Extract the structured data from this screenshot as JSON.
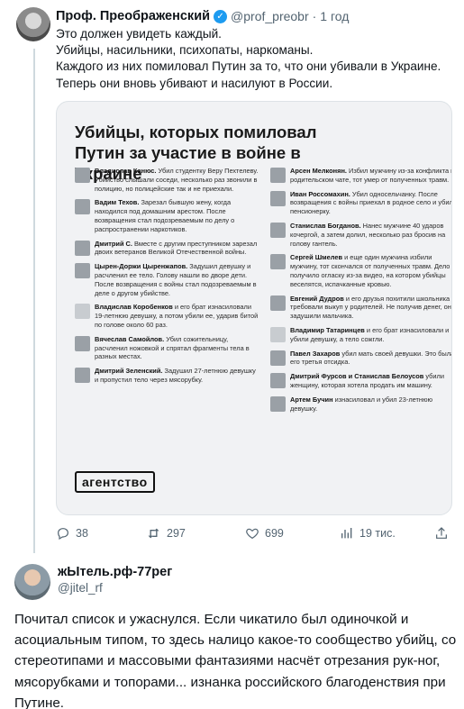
{
  "tweet1": {
    "author_name": "Проф. Преображенский",
    "handle": "@prof_preobr",
    "separator": "·",
    "time": "1 год",
    "lines": [
      "Это должен увидеть каждый.",
      "Убийцы, насильники, психопаты, наркоманы.",
      "Каждого из них помиловал Путин за то, что они убивали в Украине.",
      "Теперь они вновь убивают и насилуют в России."
    ],
    "image": {
      "title": "Убийцы, которых помиловал Путин за участие в войне в Украине",
      "logo": "агентство",
      "left": [
        {
          "name": "Владислав Канюс.",
          "text": "Убил студентку Веру Пехтелеву. Убийство слышали соседи, несколько раз звонили в полицию, но полицейские так и не приехали."
        },
        {
          "name": "Вадим Техов.",
          "text": "Зарезал бывшую жену, когда находился под домашним арестом. После возвращения стал подозреваемым по делу о распространении наркотиков."
        },
        {
          "name": "Дмитрий С.",
          "text": "Вместе с другим преступником зарезал двоих ветеранов Великой Отечественной войны."
        },
        {
          "name": "Цырен-Доржи Цыренжапов.",
          "text": "Задушил девушку и расчленил ее тело. Голову нашли во дворе дети. После возвращения с войны стал подозреваемым в деле о другом убийстве."
        },
        {
          "name": "Владислав Коробенков",
          "text": "и его брат изнасиловали 19-летнюю девушку, а потом убили ее, ударив битой по голове около 60 раз."
        },
        {
          "name": "Вячеслав Самойлов.",
          "text": "Убил сожительницу, расчленил ножовкой и спрятал фрагменты тела в разных местах."
        },
        {
          "name": "Дмитрий Зеленский.",
          "text": "Задушил 27-летнюю девушку и пропустил тело через мясорубку."
        }
      ],
      "right": [
        {
          "name": "Арсен Мелконян.",
          "text": "Избил мужчину из-за конфликта в родительском чате, тот умер от полученных травм."
        },
        {
          "name": "Иван Россомахин.",
          "text": "Убил односельчанку. После возвращения с войны приехал в родное село и убил пенсионерку."
        },
        {
          "name": "Станислав Богданов.",
          "text": "Нанес мужчине 40 ударов кочергой, а затем долил, несколько раз бросив на голову гантель."
        },
        {
          "name": "Сергей Шмелев",
          "text": "и еще один мужчина избили мужчину, тот скончался от полученных травм. Дело получило огласку из-за видео, на котором убийцы веселятся, испачканные кровью."
        },
        {
          "name": "Евгений Дудров",
          "text": "и его друзья похитили школьника и требовали выкуп у родителей. Не получив денег, они задушили мальчика."
        },
        {
          "name": "Владимир Татаринцев",
          "text": "и его брат изнасиловали и убили девушку, а тело сожгли."
        },
        {
          "name": "Павел Захаров",
          "text": "убил мать своей девушки. Это была его третья отсидка."
        },
        {
          "name": "Дмитрий Фурсов и Станислав Белоусов",
          "text": "убили женщину, которая хотела продать им машину."
        },
        {
          "name": "Артем Бучин",
          "text": "изнасиловал и убил 23-летнюю девушку."
        }
      ]
    },
    "actions": {
      "replies": "38",
      "reposts": "297",
      "likes": "699",
      "views": "19 тис."
    }
  },
  "tweet2": {
    "author_name": "жЫтель.рф-77рег",
    "handle": "@jitel_rf",
    "lines": [
      "Почитал список и ужаснулся. Если чикатило был одиночкой и",
      "асоциальным типом, то здесь налицо какое-то сообщество убийц, со",
      "стереотипами и массовыми фантазиями насчёт отрезания рук-ног,",
      "мясорубками и топорами... изнанка российского благоденствия при",
      "Путине."
    ]
  },
  "colors": {
    "accent": "#1d9bf0",
    "muted": "#536471",
    "card_bg": "#f1f2f4"
  }
}
